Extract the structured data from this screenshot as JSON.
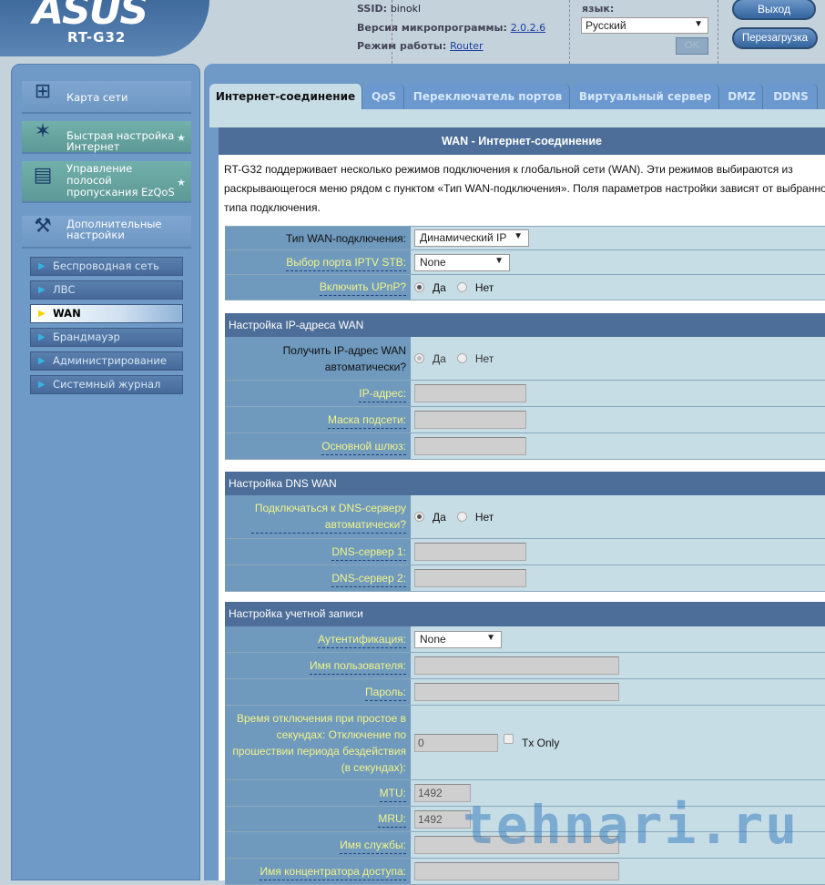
{
  "brand": {
    "logo": "ASUS",
    "model": "RT-G32"
  },
  "header": {
    "ssid_label": "SSID:",
    "ssid": "binokl",
    "fw_label": "Версия микропрограммы:",
    "fw": "2.0.2.6",
    "mode_label": "Режим работы:",
    "mode": "Router",
    "lang_label": "язык:",
    "lang": "Русский",
    "ok": "OK",
    "logout": "Выход",
    "reboot": "Перезагрузка"
  },
  "sidebar": {
    "items": [
      {
        "label": "Карта сети",
        "icon": "network-map-icon"
      },
      {
        "label": "Быстрая настройка Интернет",
        "icon": "magic-wand-icon"
      },
      {
        "label": "Управление полосой пропускания EzQoS",
        "icon": "router-icon"
      },
      {
        "label": "Дополнительные настройки",
        "icon": "tools-icon"
      }
    ],
    "sub": [
      "Беспроводная сеть",
      "ЛВС",
      "WAN",
      "Брандмауэр",
      "Администрирование",
      "Системный журнал"
    ]
  },
  "tabs": [
    "Интернет-соединение",
    "QoS",
    "Переключатель портов",
    "Виртуальный сервер",
    "DMZ",
    "DDNS"
  ],
  "page": {
    "title": "WAN - Интернет-соединение",
    "desc": [
      "RT-G32 поддерживает несколько режимов подключения к глобальной сети (WAN). Эти режимов выбираются из",
      "раскрывающегося меню рядом с пунктом «Тип WAN-подключения». Поля параметров настройки зависят от выбранного",
      "типа подключения."
    ]
  },
  "general": {
    "wan_type_label": "Тип WAN-подключения:",
    "wan_type": "Динамический IP",
    "iptv_label": "Выбор порта IPTV STB:",
    "iptv": "None",
    "upnp_label": "Включить UPnP?",
    "yes": "Да",
    "no": "Нет"
  },
  "ip": {
    "header": "Настройка IP-адреса WAN",
    "auto_label": "Получить IP-адрес WAN автоматически?",
    "ip_label": "IP-адрес:",
    "mask_label": "Маска подсети:",
    "gw_label": "Основной шлюз:"
  },
  "dns": {
    "header": "Настройка DNS WAN",
    "auto_label": "Подключаться к DNS-серверу автоматически?",
    "dns1_label": "DNS-сервер 1:",
    "dns2_label": "DNS-сервер 2:"
  },
  "account": {
    "header": "Настройка учетной записи",
    "auth_label": "Аутентификация:",
    "auth": "None",
    "user_label": "Имя пользователя:",
    "pass_label": "Пароль:",
    "idle_label": "Время отключения при простое в секундах: Отключение по прошествии периода бездействия (в секундах):",
    "idle": "0",
    "tx_only": "Tx Only",
    "mtu_label": "MTU:",
    "mtu": "1492",
    "mru_label": "MRU:",
    "mru": "1492",
    "service_label": "Имя службы:",
    "ac_label": "Имя концентратора доступа:"
  },
  "watermark": "tehnari.ru"
}
